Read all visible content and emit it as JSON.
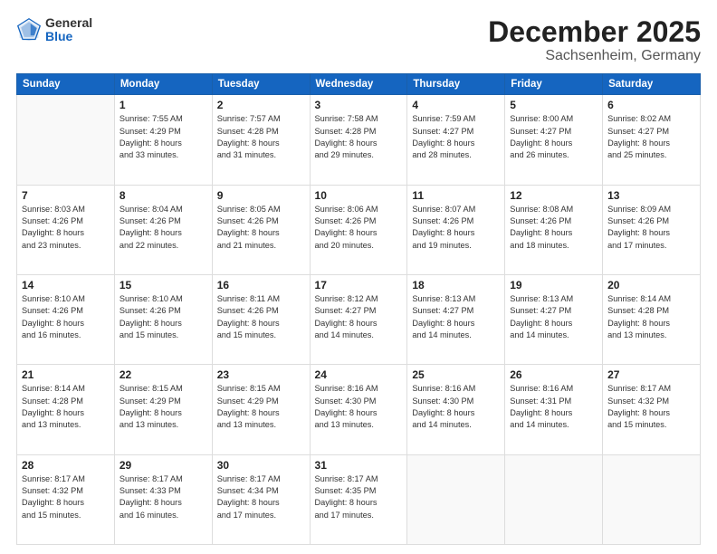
{
  "header": {
    "logo_general": "General",
    "logo_blue": "Blue",
    "month": "December 2025",
    "location": "Sachsenheim, Germany"
  },
  "days_of_week": [
    "Sunday",
    "Monday",
    "Tuesday",
    "Wednesday",
    "Thursday",
    "Friday",
    "Saturday"
  ],
  "weeks": [
    [
      {
        "day": "",
        "info": ""
      },
      {
        "day": "1",
        "info": "Sunrise: 7:55 AM\nSunset: 4:29 PM\nDaylight: 8 hours\nand 33 minutes."
      },
      {
        "day": "2",
        "info": "Sunrise: 7:57 AM\nSunset: 4:28 PM\nDaylight: 8 hours\nand 31 minutes."
      },
      {
        "day": "3",
        "info": "Sunrise: 7:58 AM\nSunset: 4:28 PM\nDaylight: 8 hours\nand 29 minutes."
      },
      {
        "day": "4",
        "info": "Sunrise: 7:59 AM\nSunset: 4:27 PM\nDaylight: 8 hours\nand 28 minutes."
      },
      {
        "day": "5",
        "info": "Sunrise: 8:00 AM\nSunset: 4:27 PM\nDaylight: 8 hours\nand 26 minutes."
      },
      {
        "day": "6",
        "info": "Sunrise: 8:02 AM\nSunset: 4:27 PM\nDaylight: 8 hours\nand 25 minutes."
      }
    ],
    [
      {
        "day": "7",
        "info": "Sunrise: 8:03 AM\nSunset: 4:26 PM\nDaylight: 8 hours\nand 23 minutes."
      },
      {
        "day": "8",
        "info": "Sunrise: 8:04 AM\nSunset: 4:26 PM\nDaylight: 8 hours\nand 22 minutes."
      },
      {
        "day": "9",
        "info": "Sunrise: 8:05 AM\nSunset: 4:26 PM\nDaylight: 8 hours\nand 21 minutes."
      },
      {
        "day": "10",
        "info": "Sunrise: 8:06 AM\nSunset: 4:26 PM\nDaylight: 8 hours\nand 20 minutes."
      },
      {
        "day": "11",
        "info": "Sunrise: 8:07 AM\nSunset: 4:26 PM\nDaylight: 8 hours\nand 19 minutes."
      },
      {
        "day": "12",
        "info": "Sunrise: 8:08 AM\nSunset: 4:26 PM\nDaylight: 8 hours\nand 18 minutes."
      },
      {
        "day": "13",
        "info": "Sunrise: 8:09 AM\nSunset: 4:26 PM\nDaylight: 8 hours\nand 17 minutes."
      }
    ],
    [
      {
        "day": "14",
        "info": "Sunrise: 8:10 AM\nSunset: 4:26 PM\nDaylight: 8 hours\nand 16 minutes."
      },
      {
        "day": "15",
        "info": "Sunrise: 8:10 AM\nSunset: 4:26 PM\nDaylight: 8 hours\nand 15 minutes."
      },
      {
        "day": "16",
        "info": "Sunrise: 8:11 AM\nSunset: 4:26 PM\nDaylight: 8 hours\nand 15 minutes."
      },
      {
        "day": "17",
        "info": "Sunrise: 8:12 AM\nSunset: 4:27 PM\nDaylight: 8 hours\nand 14 minutes."
      },
      {
        "day": "18",
        "info": "Sunrise: 8:13 AM\nSunset: 4:27 PM\nDaylight: 8 hours\nand 14 minutes."
      },
      {
        "day": "19",
        "info": "Sunrise: 8:13 AM\nSunset: 4:27 PM\nDaylight: 8 hours\nand 14 minutes."
      },
      {
        "day": "20",
        "info": "Sunrise: 8:14 AM\nSunset: 4:28 PM\nDaylight: 8 hours\nand 13 minutes."
      }
    ],
    [
      {
        "day": "21",
        "info": "Sunrise: 8:14 AM\nSunset: 4:28 PM\nDaylight: 8 hours\nand 13 minutes."
      },
      {
        "day": "22",
        "info": "Sunrise: 8:15 AM\nSunset: 4:29 PM\nDaylight: 8 hours\nand 13 minutes."
      },
      {
        "day": "23",
        "info": "Sunrise: 8:15 AM\nSunset: 4:29 PM\nDaylight: 8 hours\nand 13 minutes."
      },
      {
        "day": "24",
        "info": "Sunrise: 8:16 AM\nSunset: 4:30 PM\nDaylight: 8 hours\nand 13 minutes."
      },
      {
        "day": "25",
        "info": "Sunrise: 8:16 AM\nSunset: 4:30 PM\nDaylight: 8 hours\nand 14 minutes."
      },
      {
        "day": "26",
        "info": "Sunrise: 8:16 AM\nSunset: 4:31 PM\nDaylight: 8 hours\nand 14 minutes."
      },
      {
        "day": "27",
        "info": "Sunrise: 8:17 AM\nSunset: 4:32 PM\nDaylight: 8 hours\nand 15 minutes."
      }
    ],
    [
      {
        "day": "28",
        "info": "Sunrise: 8:17 AM\nSunset: 4:32 PM\nDaylight: 8 hours\nand 15 minutes."
      },
      {
        "day": "29",
        "info": "Sunrise: 8:17 AM\nSunset: 4:33 PM\nDaylight: 8 hours\nand 16 minutes."
      },
      {
        "day": "30",
        "info": "Sunrise: 8:17 AM\nSunset: 4:34 PM\nDaylight: 8 hours\nand 17 minutes."
      },
      {
        "day": "31",
        "info": "Sunrise: 8:17 AM\nSunset: 4:35 PM\nDaylight: 8 hours\nand 17 minutes."
      },
      {
        "day": "",
        "info": ""
      },
      {
        "day": "",
        "info": ""
      },
      {
        "day": "",
        "info": ""
      }
    ]
  ]
}
